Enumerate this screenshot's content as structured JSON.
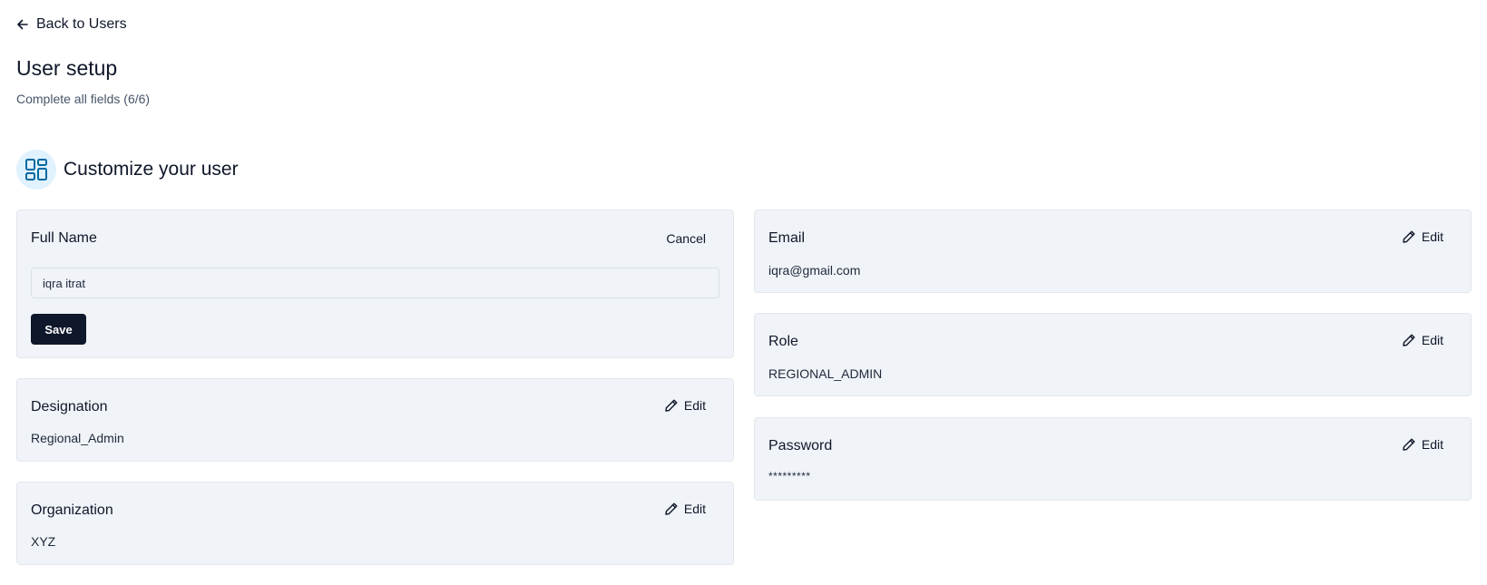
{
  "nav": {
    "back_label": "Back to Users"
  },
  "header": {
    "title": "User setup",
    "subtitle": "Complete all fields (6/6)"
  },
  "section": {
    "title": "Customize your user"
  },
  "fields": {
    "full_name": {
      "label": "Full Name",
      "value": "iqra itrat",
      "cancel_label": "Cancel",
      "save_label": "Save"
    },
    "designation": {
      "label": "Designation",
      "value": "Regional_Admin",
      "edit_label": "Edit"
    },
    "organization": {
      "label": "Organization",
      "value": "XYZ",
      "edit_label": "Edit"
    },
    "email": {
      "label": "Email",
      "value": "iqra@gmail.com",
      "edit_label": "Edit"
    },
    "role": {
      "label": "Role",
      "value": "REGIONAL_ADMIN",
      "edit_label": "Edit"
    },
    "password": {
      "label": "Password",
      "value": "*********",
      "edit_label": "Edit"
    }
  },
  "icons": {
    "back": "arrow-left-icon",
    "section": "dashboard-grid-icon",
    "edit": "pencil-icon"
  },
  "colors": {
    "primary_button": "#0f172a",
    "card_background": "#f0f3f7",
    "icon_accent": "#0369a1",
    "icon_background": "#e0f2fe"
  }
}
